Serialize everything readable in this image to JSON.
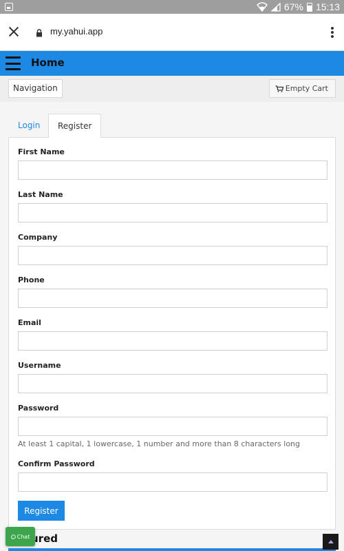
{
  "status_bar": {
    "battery": "67%",
    "time": "15:13"
  },
  "browser": {
    "url": "my.yahui.app"
  },
  "header": {
    "title": "Home"
  },
  "nav": {
    "navigation_label": "Navigation",
    "cart_label": "Empty Cart"
  },
  "tabs": {
    "login": "Login",
    "register": "Register"
  },
  "form": {
    "first_name": "First Name",
    "last_name": "Last Name",
    "company": "Company",
    "phone": "Phone",
    "email": "Email",
    "username": "Username",
    "password": "Password",
    "password_help": "At least 1 capital, 1 lowercase, 1 number and more than 8 characters long",
    "confirm_password": "Confirm Password",
    "register_button": "Register"
  },
  "section": {
    "partial_heading": "ured"
  },
  "chat": {
    "label": "Chat"
  },
  "colors": {
    "accent": "#1e88e5",
    "chat": "#3ea64a",
    "status_bar": "#9e9e9e"
  }
}
